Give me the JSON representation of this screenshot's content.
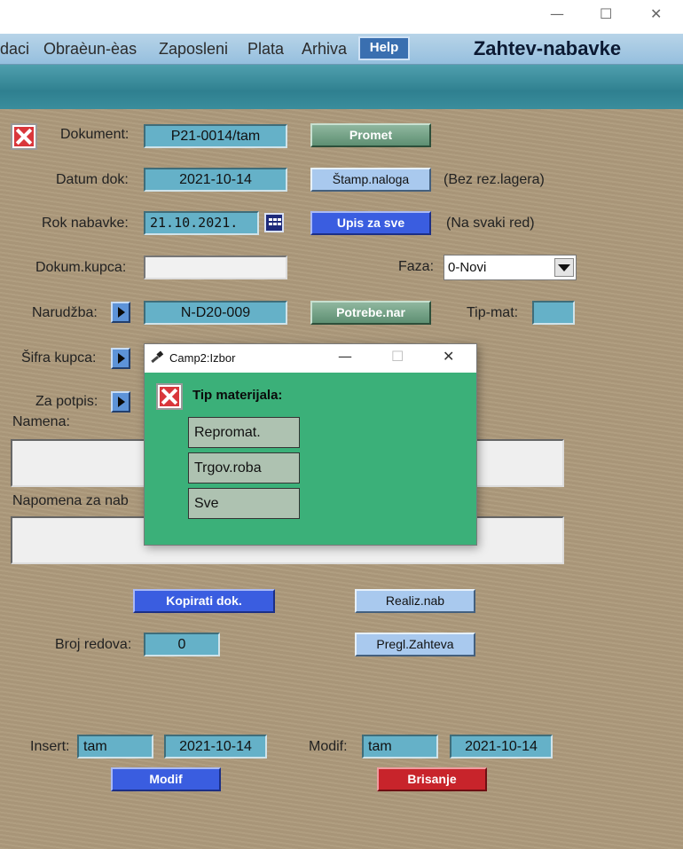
{
  "window": {
    "minimize": "—",
    "maximize": "☐",
    "close": "✕"
  },
  "menu": {
    "items": [
      "daci",
      "Obraèun-èas",
      "Zaposleni",
      "Plata",
      "Arhiva"
    ],
    "help": "Help",
    "title": "Zahtev-nabavke"
  },
  "form": {
    "dokument_label": "Dokument:",
    "dokument_value": "P21-0014/tam",
    "promet_button": "Promet",
    "datum_label": "Datum dok:",
    "datum_value": "2021-10-14",
    "stamp_button": "Štamp.naloga",
    "stamp_note": "(Bez rez.lagera)",
    "rok_label": "Rok nabavke:",
    "rok_value": "21.10.2021.",
    "upis_button": "Upis za sve",
    "upis_note": "(Na svaki red)",
    "dokum_kupca_label": "Dokum.kupca:",
    "dokum_kupca_value": "",
    "faza_label": "Faza:",
    "faza_value": "0-Novi",
    "narudzba_label": "Narudžba:",
    "narudzba_value": "N-D20-009",
    "potrebe_button": "Potrebe.nar",
    "tipmat_label": "Tip-mat:",
    "tipmat_value": "",
    "sifra_label": "Šifra kupca:",
    "potpis_label": "Za potpis:",
    "namena_label": "Namena:",
    "napomena_label": "Napomena za nab",
    "kopirati_button": "Kopirati dok.",
    "realiz_button": "Realiz.nab",
    "broj_label": "Broj redova:",
    "broj_value": "0",
    "pregl_button": "Pregl.Zahteva",
    "insert_label": "Insert:",
    "insert_user": "tam",
    "insert_date": "2021-10-14",
    "modif_label": "Modif:",
    "modif_user": "tam",
    "modif_date": "2021-10-14",
    "modif_button": "Modif",
    "brisanje_button": "Brisanje"
  },
  "popup": {
    "title": "Camp2:Izbor",
    "heading": "Tip materijala:",
    "options": [
      "Repromat.",
      "Trgov.roba",
      "Sve"
    ],
    "minimize": "—",
    "maximize": "☐",
    "close": "✕"
  },
  "colors": {
    "background": "#ad9a7c",
    "field": "#65b1c8",
    "popup": "#3bb079",
    "accent_blue": "#3a5de0",
    "danger": "#c8242b"
  }
}
